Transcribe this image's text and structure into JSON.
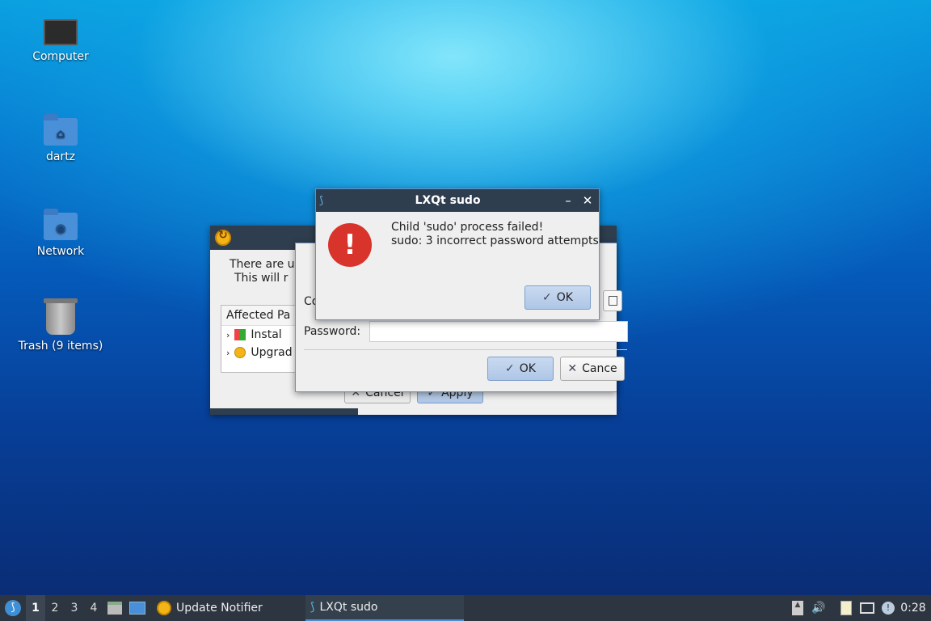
{
  "desktop": {
    "icons": [
      {
        "label": "Computer",
        "icon": "computer-icon"
      },
      {
        "label": "dartz",
        "icon": "home-folder-icon"
      },
      {
        "label": "Network",
        "icon": "network-folder-icon"
      },
      {
        "label": "Trash (9 items)",
        "icon": "trash-icon"
      }
    ]
  },
  "update_window": {
    "message_line1": "There are u",
    "message_line2": "This will r",
    "affected_header": "Affected Pa",
    "tree_items": [
      "Instal",
      "Upgrad"
    ],
    "cancel_label": "Cancel",
    "apply_label": "Apply"
  },
  "password_window": {
    "command_label": "Co",
    "password_label": "Password:",
    "password_value": "",
    "ok_label": "OK",
    "cancel_label": "Cance"
  },
  "error_dialog": {
    "title": "LXQt sudo",
    "message_line1": "Child 'sudo' process failed!",
    "message_line2": "sudo: 3 incorrect password attempts",
    "ok_label": "OK",
    "minimize_glyph": "–",
    "close_glyph": "✕"
  },
  "taskbar": {
    "workspaces": [
      "1",
      "2",
      "3",
      "4"
    ],
    "active_workspace": "1",
    "tasks": [
      {
        "label": "Update Notifier",
        "icon": "update-notifier-icon"
      },
      {
        "label": "LXQt sudo",
        "icon": "lxqt-sudo-icon"
      }
    ],
    "clock": "0:28"
  }
}
